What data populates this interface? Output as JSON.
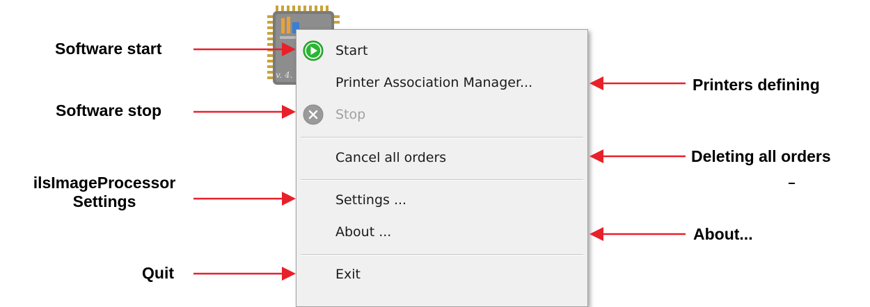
{
  "app_icon": {
    "icon": "ils-chip-icon",
    "logo_text": "ils",
    "version_text": "v. 4."
  },
  "menu": {
    "items": [
      {
        "label": "Start",
        "icon": "play-icon",
        "enabled": true
      },
      {
        "label": "Printer Association Manager...",
        "icon": null,
        "enabled": true
      },
      {
        "label": "Stop",
        "icon": "stop-icon",
        "enabled": false
      },
      {
        "label": "Cancel all orders",
        "icon": null,
        "enabled": true
      },
      {
        "label": "Settings ...",
        "icon": null,
        "enabled": true
      },
      {
        "label": "About ...",
        "icon": null,
        "enabled": true
      },
      {
        "label": "Exit",
        "icon": null,
        "enabled": true
      }
    ]
  },
  "annotations": {
    "software_start": "Software start",
    "software_stop": "Software stop",
    "settings_line1": "ilsImageProcessor",
    "settings_line2": "Settings",
    "quit": "Quit",
    "printers_defining": "Printers defining",
    "deleting_all_orders": "Deleting all orders",
    "about": "About..."
  },
  "colors": {
    "arrow": "#e8202a",
    "menu_background": "#f0f0f0",
    "start_icon_green": "#2bb532",
    "stop_icon_gray": "#9a9a9a",
    "disabled_text": "#a0a0a0"
  }
}
